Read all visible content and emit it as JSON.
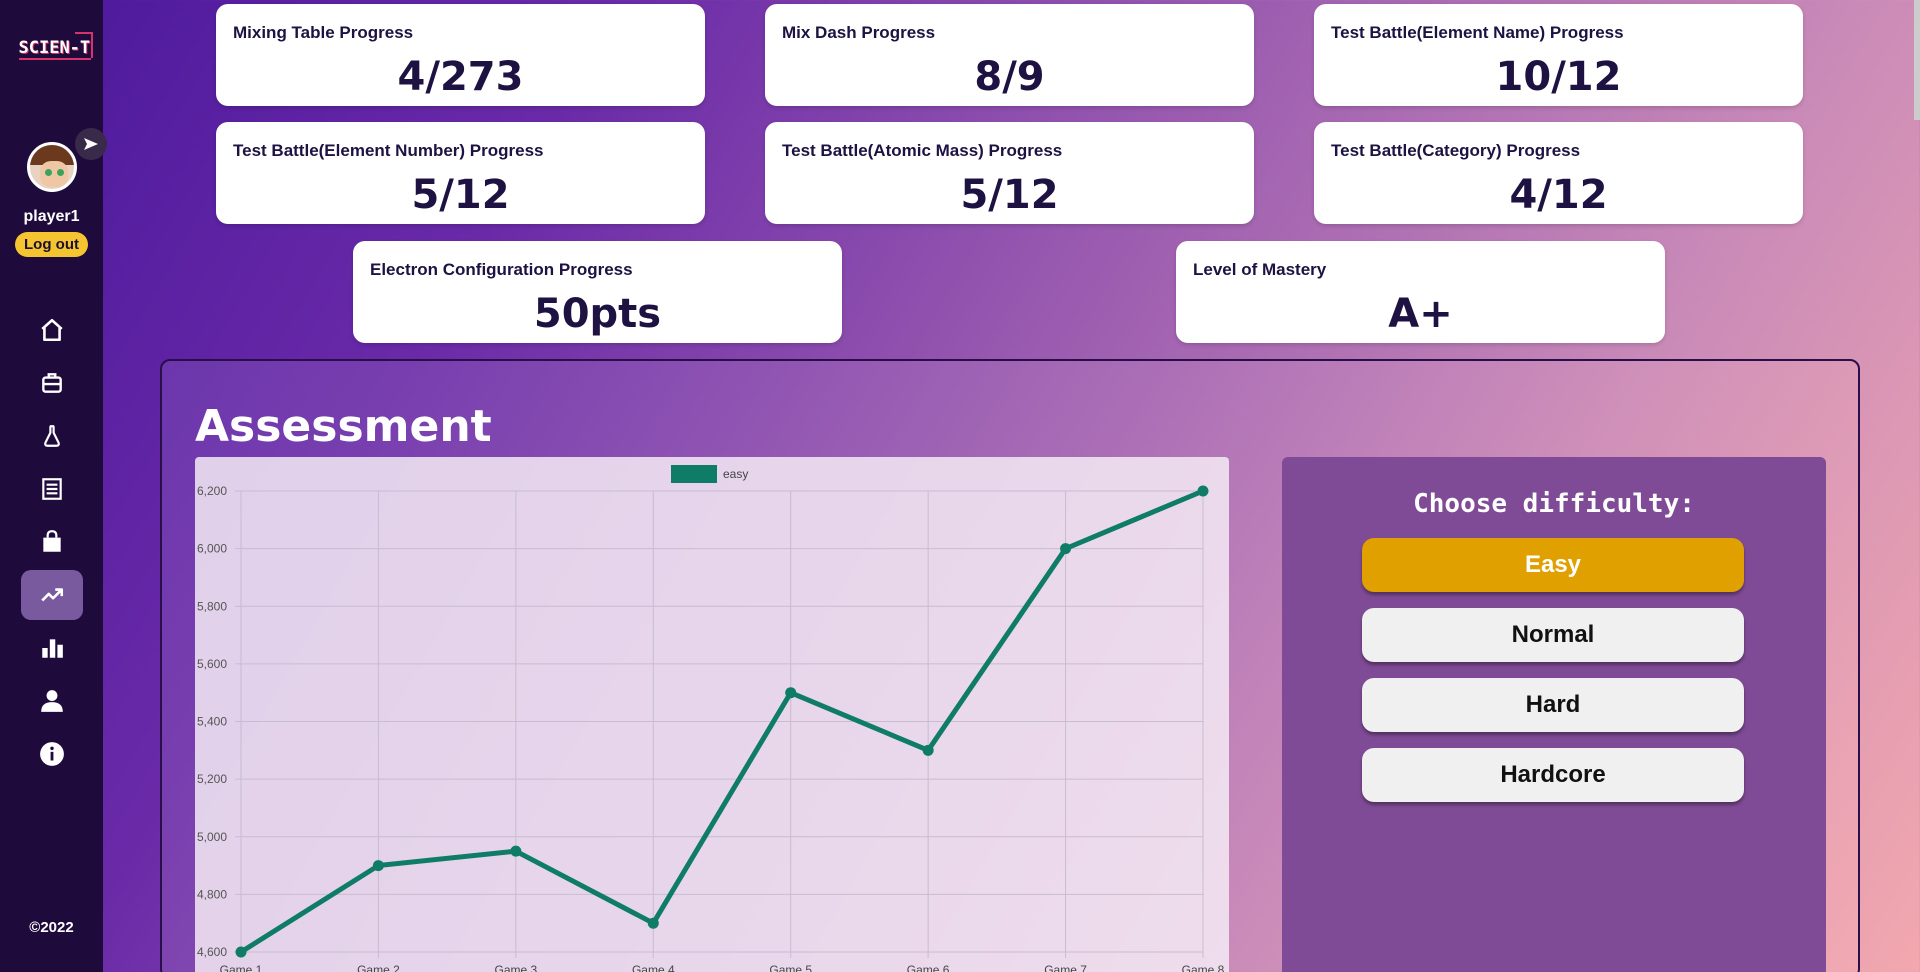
{
  "sidebar": {
    "logo": "SCIEN-T",
    "username": "player1",
    "logout_label": "Log out",
    "copyright": "©2022",
    "nav_icons": [
      "home-icon",
      "briefcase-icon",
      "flask-icon",
      "notebook-icon",
      "shopping-bag-icon",
      "trending-up-icon",
      "bar-chart-icon",
      "user-icon",
      "info-icon"
    ],
    "active_index": 5
  },
  "cards": [
    {
      "label": "Mixing Table Progress",
      "value": "4/273"
    },
    {
      "label": "Mix Dash Progress",
      "value": "8/9"
    },
    {
      "label": "Test Battle(Element Name) Progress",
      "value": "10/12"
    },
    {
      "label": "Test Battle(Element Number) Progress",
      "value": "5/12"
    },
    {
      "label": "Test Battle(Atomic Mass) Progress",
      "value": "5/12"
    },
    {
      "label": "Test Battle(Category) Progress",
      "value": "4/12"
    },
    {
      "label": "Electron Configuration Progress",
      "value": "50pts"
    },
    {
      "label": "Level of Mastery",
      "value": "A+"
    }
  ],
  "assessment": {
    "title": "Assessment",
    "difficulty_title": "Choose difficulty:",
    "difficulties": [
      "Easy",
      "Normal",
      "Hard",
      "Hardcore"
    ],
    "selected": "Easy"
  },
  "chart_data": {
    "type": "line",
    "categories": [
      "Game 1",
      "Game 2",
      "Game 3",
      "Game 4",
      "Game 5",
      "Game 6",
      "Game 7",
      "Game 8"
    ],
    "series": [
      {
        "name": "easy",
        "values": [
          4600,
          4900,
          4950,
          4700,
          5500,
          5300,
          6000,
          6200
        ],
        "color": "#0e7c66"
      }
    ],
    "y_ticks": [
      "4,600",
      "4,800",
      "5,000",
      "5,200",
      "5,400",
      "5,600",
      "5,800",
      "6,000",
      "6,200"
    ],
    "ylim": [
      4600,
      6200
    ],
    "grid": true,
    "legend": "top"
  },
  "colors": {
    "accent": "#e0a000",
    "sidebar": "#1f0a3c",
    "line": "#0e7c66"
  }
}
